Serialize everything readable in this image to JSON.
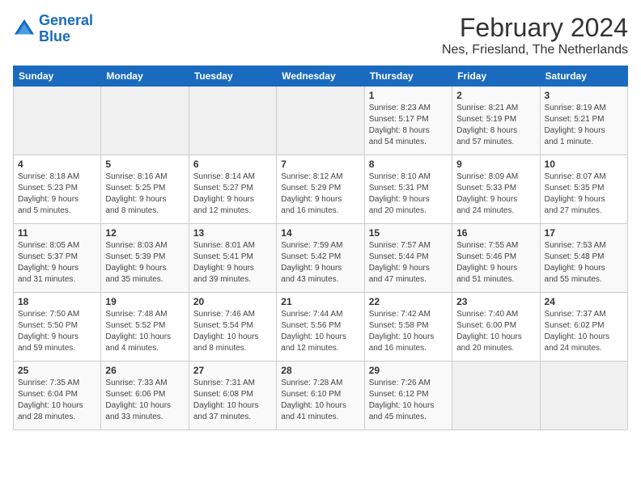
{
  "header": {
    "logo_line1": "General",
    "logo_line2": "Blue",
    "month_year": "February 2024",
    "location": "Nes, Friesland, The Netherlands"
  },
  "weekdays": [
    "Sunday",
    "Monday",
    "Tuesday",
    "Wednesday",
    "Thursday",
    "Friday",
    "Saturday"
  ],
  "weeks": [
    [
      {
        "day": "",
        "info": ""
      },
      {
        "day": "",
        "info": ""
      },
      {
        "day": "",
        "info": ""
      },
      {
        "day": "",
        "info": ""
      },
      {
        "day": "1",
        "info": "Sunrise: 8:23 AM\nSunset: 5:17 PM\nDaylight: 8 hours\nand 54 minutes."
      },
      {
        "day": "2",
        "info": "Sunrise: 8:21 AM\nSunset: 5:19 PM\nDaylight: 8 hours\nand 57 minutes."
      },
      {
        "day": "3",
        "info": "Sunrise: 8:19 AM\nSunset: 5:21 PM\nDaylight: 9 hours\nand 1 minute."
      }
    ],
    [
      {
        "day": "4",
        "info": "Sunrise: 8:18 AM\nSunset: 5:23 PM\nDaylight: 9 hours\nand 5 minutes."
      },
      {
        "day": "5",
        "info": "Sunrise: 8:16 AM\nSunset: 5:25 PM\nDaylight: 9 hours\nand 8 minutes."
      },
      {
        "day": "6",
        "info": "Sunrise: 8:14 AM\nSunset: 5:27 PM\nDaylight: 9 hours\nand 12 minutes."
      },
      {
        "day": "7",
        "info": "Sunrise: 8:12 AM\nSunset: 5:29 PM\nDaylight: 9 hours\nand 16 minutes."
      },
      {
        "day": "8",
        "info": "Sunrise: 8:10 AM\nSunset: 5:31 PM\nDaylight: 9 hours\nand 20 minutes."
      },
      {
        "day": "9",
        "info": "Sunrise: 8:09 AM\nSunset: 5:33 PM\nDaylight: 9 hours\nand 24 minutes."
      },
      {
        "day": "10",
        "info": "Sunrise: 8:07 AM\nSunset: 5:35 PM\nDaylight: 9 hours\nand 27 minutes."
      }
    ],
    [
      {
        "day": "11",
        "info": "Sunrise: 8:05 AM\nSunset: 5:37 PM\nDaylight: 9 hours\nand 31 minutes."
      },
      {
        "day": "12",
        "info": "Sunrise: 8:03 AM\nSunset: 5:39 PM\nDaylight: 9 hours\nand 35 minutes."
      },
      {
        "day": "13",
        "info": "Sunrise: 8:01 AM\nSunset: 5:41 PM\nDaylight: 9 hours\nand 39 minutes."
      },
      {
        "day": "14",
        "info": "Sunrise: 7:59 AM\nSunset: 5:42 PM\nDaylight: 9 hours\nand 43 minutes."
      },
      {
        "day": "15",
        "info": "Sunrise: 7:57 AM\nSunset: 5:44 PM\nDaylight: 9 hours\nand 47 minutes."
      },
      {
        "day": "16",
        "info": "Sunrise: 7:55 AM\nSunset: 5:46 PM\nDaylight: 9 hours\nand 51 minutes."
      },
      {
        "day": "17",
        "info": "Sunrise: 7:53 AM\nSunset: 5:48 PM\nDaylight: 9 hours\nand 55 minutes."
      }
    ],
    [
      {
        "day": "18",
        "info": "Sunrise: 7:50 AM\nSunset: 5:50 PM\nDaylight: 9 hours\nand 59 minutes."
      },
      {
        "day": "19",
        "info": "Sunrise: 7:48 AM\nSunset: 5:52 PM\nDaylight: 10 hours\nand 4 minutes."
      },
      {
        "day": "20",
        "info": "Sunrise: 7:46 AM\nSunset: 5:54 PM\nDaylight: 10 hours\nand 8 minutes."
      },
      {
        "day": "21",
        "info": "Sunrise: 7:44 AM\nSunset: 5:56 PM\nDaylight: 10 hours\nand 12 minutes."
      },
      {
        "day": "22",
        "info": "Sunrise: 7:42 AM\nSunset: 5:58 PM\nDaylight: 10 hours\nand 16 minutes."
      },
      {
        "day": "23",
        "info": "Sunrise: 7:40 AM\nSunset: 6:00 PM\nDaylight: 10 hours\nand 20 minutes."
      },
      {
        "day": "24",
        "info": "Sunrise: 7:37 AM\nSunset: 6:02 PM\nDaylight: 10 hours\nand 24 minutes."
      }
    ],
    [
      {
        "day": "25",
        "info": "Sunrise: 7:35 AM\nSunset: 6:04 PM\nDaylight: 10 hours\nand 28 minutes."
      },
      {
        "day": "26",
        "info": "Sunrise: 7:33 AM\nSunset: 6:06 PM\nDaylight: 10 hours\nand 33 minutes."
      },
      {
        "day": "27",
        "info": "Sunrise: 7:31 AM\nSunset: 6:08 PM\nDaylight: 10 hours\nand 37 minutes."
      },
      {
        "day": "28",
        "info": "Sunrise: 7:28 AM\nSunset: 6:10 PM\nDaylight: 10 hours\nand 41 minutes."
      },
      {
        "day": "29",
        "info": "Sunrise: 7:26 AM\nSunset: 6:12 PM\nDaylight: 10 hours\nand 45 minutes."
      },
      {
        "day": "",
        "info": ""
      },
      {
        "day": "",
        "info": ""
      }
    ]
  ]
}
